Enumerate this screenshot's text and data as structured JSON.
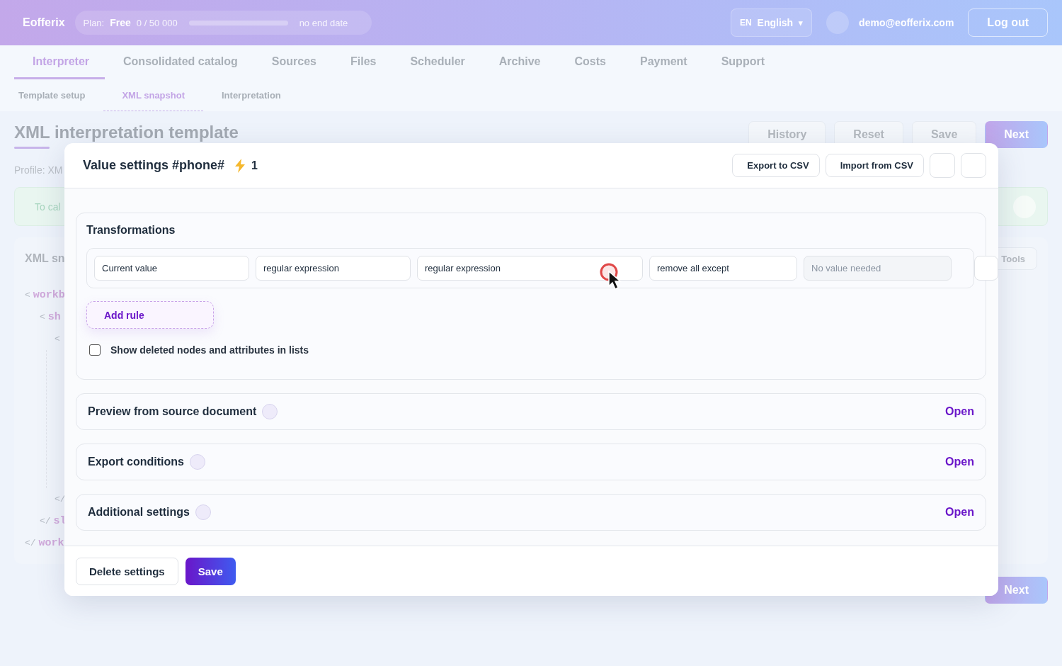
{
  "header": {
    "logo": "Eofferix",
    "plan": {
      "label": "Plan:",
      "name": "Free",
      "usage": "0 / 50 000",
      "level": 0,
      "end": "no end date"
    },
    "language": {
      "code": "EN",
      "name": "English",
      "caret": "▾"
    },
    "email": "demo@eofferix.com",
    "logout": "Log out"
  },
  "nav": [
    {
      "label": "Interpreter",
      "selected": true
    },
    {
      "label": "Consolidated catalog",
      "selected": false
    },
    {
      "label": "Sources",
      "selected": false
    },
    {
      "label": "Files",
      "selected": false
    },
    {
      "label": "Scheduler",
      "selected": false
    },
    {
      "label": "Archive",
      "selected": false
    },
    {
      "label": "Costs",
      "selected": false
    },
    {
      "label": "Payment",
      "selected": false
    },
    {
      "label": "Support",
      "selected": false
    }
  ],
  "subtabs": [
    {
      "label": "Template setup",
      "selected": false
    },
    {
      "label": "XML snapshot",
      "selected": true
    },
    {
      "label": "Interpretation",
      "selected": false
    }
  ],
  "page": {
    "title": "XML interpretation template",
    "actions": [
      {
        "label": "History",
        "primary": false
      },
      {
        "label": "Reset",
        "primary": false
      },
      {
        "label": "Save",
        "primary": false
      },
      {
        "label": "Next",
        "primary": true
      }
    ],
    "profile": "Profile: XM",
    "notice": "To cal",
    "snapshot": {
      "title": "XML sn",
      "tools": "Tools",
      "open_lines": [
        {
          "bracket": "<",
          "tag": "workb",
          "children": [
            {
              "bracket": "<",
              "tag": "sh",
              "children": [
                {
                  "bracket": "<"
                }
              ]
            }
          ]
        }
      ],
      "close_lines": [
        {
          "bracket": "</",
          "tag": "work",
          "children": [
            {
              "bracket": "</",
              "tag": "sl",
              "children": [
                {
                  "bracket": "</"
                }
              ]
            }
          ]
        }
      ]
    },
    "bottom_action": "Next"
  },
  "modal": {
    "title": "Value settings #phone#",
    "count": "1",
    "buttons": [
      "Export to CSV",
      "Import from CSV"
    ],
    "transformations": {
      "title": "Transformations",
      "fields": [
        {
          "value": "Current value"
        },
        {
          "value": "regular expression"
        },
        {
          "value": "regular expression"
        },
        {
          "value": "remove all except"
        },
        {
          "placeholder": "No value needed"
        }
      ],
      "add_rule": "Add rule",
      "show_deleted": {
        "label": "Show deleted nodes and attributes in lists",
        "checked": false
      }
    },
    "sections": [
      {
        "title": "Preview from source document",
        "action": "Open"
      },
      {
        "title": "Export conditions",
        "action": "Open"
      },
      {
        "title": "Additional settings",
        "action": "Open"
      }
    ],
    "footer": {
      "delete": "Delete settings",
      "save": "Save"
    }
  }
}
